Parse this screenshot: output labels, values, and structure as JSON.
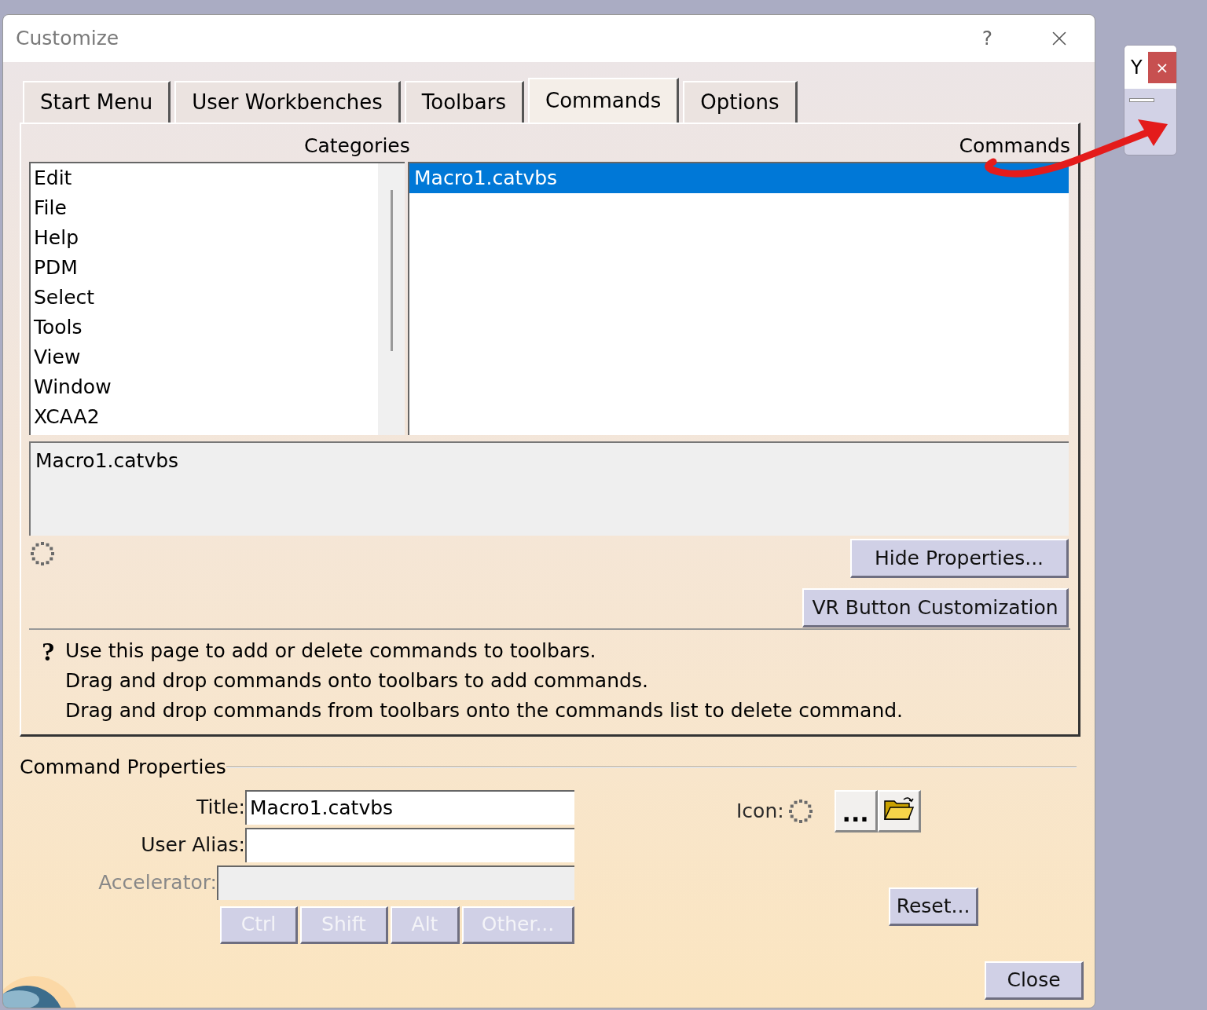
{
  "window": {
    "title": "Customize",
    "help_button": "?"
  },
  "tabs": [
    {
      "label": "Start Menu",
      "selected": false
    },
    {
      "label": "User Workbenches",
      "selected": false
    },
    {
      "label": "Toolbars",
      "selected": false
    },
    {
      "label": "Commands",
      "selected": true
    },
    {
      "label": "Options",
      "selected": false
    }
  ],
  "categories_label": "Categories",
  "commands_label": "Commands",
  "categories": [
    {
      "label": "Edit",
      "selected": false
    },
    {
      "label": "File",
      "selected": false
    },
    {
      "label": "Help",
      "selected": false
    },
    {
      "label": "PDM",
      "selected": false
    },
    {
      "label": "Select",
      "selected": false
    },
    {
      "label": "Tools",
      "selected": false
    },
    {
      "label": "View",
      "selected": false
    },
    {
      "label": "Window",
      "selected": false
    },
    {
      "label": "XCAA2",
      "selected": false
    }
  ],
  "commands": [
    {
      "label": "Macro1.catvbs",
      "selected": true
    }
  ],
  "description": "Macro1.catvbs",
  "hide_properties_button": "Hide Properties...",
  "vr_button": "VR Button Customization",
  "help_icon": "?",
  "help_lines": [
    "Use this page to add or delete commands to toolbars.",
    "Drag and drop commands onto toolbars to add commands.",
    "Drag and drop commands from toolbars onto the commands list to delete command."
  ],
  "command_properties": {
    "title": "Command Properties",
    "fields": [
      {
        "label": "Title:",
        "value": "Macro1.catvbs",
        "disabled": false
      },
      {
        "label": "User Alias:",
        "disabled": false
      },
      {
        "label": "Accelerator:",
        "disabled": true
      }
    ],
    "modifiers": [
      {
        "label": "Ctrl",
        "disabled": true
      },
      {
        "label": "Shift",
        "disabled": true
      },
      {
        "label": "Alt",
        "disabled": true
      },
      {
        "label": "Other...",
        "disabled": true
      }
    ],
    "icon_label": "Icon:",
    "browse_button": "...",
    "reset_button": "Reset..."
  },
  "close_button": "Close",
  "side_window": {
    "title": "Y",
    "close": "×"
  }
}
